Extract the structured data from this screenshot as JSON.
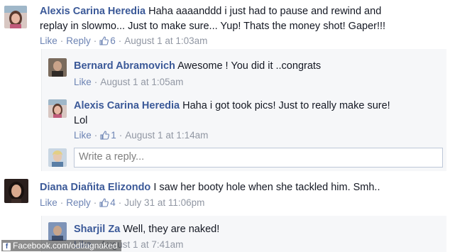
{
  "comments": [
    {
      "name": "Alexis Carina Heredia",
      "text_line1": "Haha aaaanddd i just had to pause and rewind and",
      "text_line2": "replay in slowmo... Just to make sure... Yup! Thats the money shot! Gaper!!!",
      "like": "Like",
      "reply": "Reply",
      "likes": "6",
      "date": "August 1 at 1:03am"
    },
    {
      "name": "Diana Diañita Elizondo",
      "text_line1": "I saw her booty hole when she tackled him. Smh..",
      "like": "Like",
      "reply": "Reply",
      "likes": "4",
      "date": "July 31 at 11:06pm"
    }
  ],
  "replies": [
    {
      "name": "Bernard Abramovich",
      "text_line1": "Awesome ! You did it ..congrats",
      "like": "Like",
      "date": "August 1 at 1:05am"
    },
    {
      "name": "Alexis Carina Heredia",
      "text_line1": "Haha i got took pics! Just to really make sure!",
      "text_line2": "Lol",
      "like": "Like",
      "likes": "1",
      "date": "August 1 at 1:14am"
    },
    {
      "name": "Sharjil Za",
      "text_line1": "Well, they are naked!",
      "like": "Like",
      "date": "August 1 at 7:41am"
    }
  ],
  "reply_box": {
    "placeholder": "Write a reply..."
  },
  "watermark": {
    "text": "Facebook.com/odtlagnaked"
  },
  "colors": {
    "name_blue": "#3b5998",
    "link_blue": "#6d84b4",
    "grey": "#9197a3",
    "thread_bg": "#f6f7f9"
  },
  "icons": [
    "thumbs-up-icon",
    "avatar-photo",
    "facebook-f-icon"
  ]
}
